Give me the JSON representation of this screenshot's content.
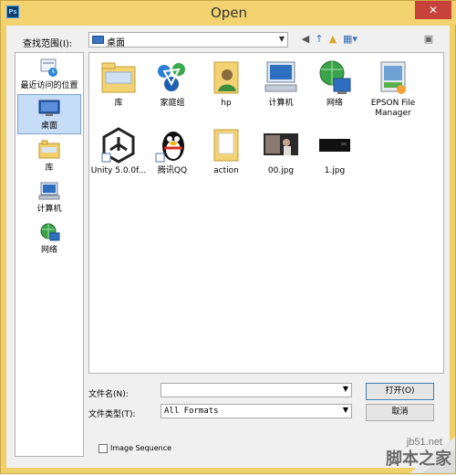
{
  "window": {
    "title": "Open",
    "app_icon_text": "Ps",
    "close_glyph": "✕"
  },
  "lookin": {
    "label": "查找范围(I):",
    "value": "桌面"
  },
  "toolbar": {
    "back_icon": "◀",
    "up_icon": "↑",
    "newfolder_icon": "▲",
    "view_icon": "▦▾",
    "extra_icon": "▣"
  },
  "places": [
    {
      "label": "最近访问的位置"
    },
    {
      "label": "桌面"
    },
    {
      "label": "库"
    },
    {
      "label": "计算机"
    },
    {
      "label": "网络"
    }
  ],
  "files": [
    {
      "name": "库"
    },
    {
      "name": "家庭组"
    },
    {
      "name": "hp"
    },
    {
      "name": "计算机"
    },
    {
      "name": "网络"
    },
    {
      "name": "EPSON File Manager"
    },
    {
      "name": "Unity 5.0.0f..."
    },
    {
      "name": "腾讯QQ"
    },
    {
      "name": "action"
    },
    {
      "name": "00.jpg"
    },
    {
      "name": "1.jpg"
    }
  ],
  "filename": {
    "label": "文件名(N):",
    "value": ""
  },
  "filetype": {
    "label": "文件类型(T):",
    "value": "All Formats"
  },
  "buttons": {
    "open": "打开(O)",
    "cancel": "取消"
  },
  "image_sequence": {
    "label": "Image Sequence",
    "checked": false
  },
  "watermark": {
    "url": "jb51.net",
    "site": "脚本之家"
  }
}
